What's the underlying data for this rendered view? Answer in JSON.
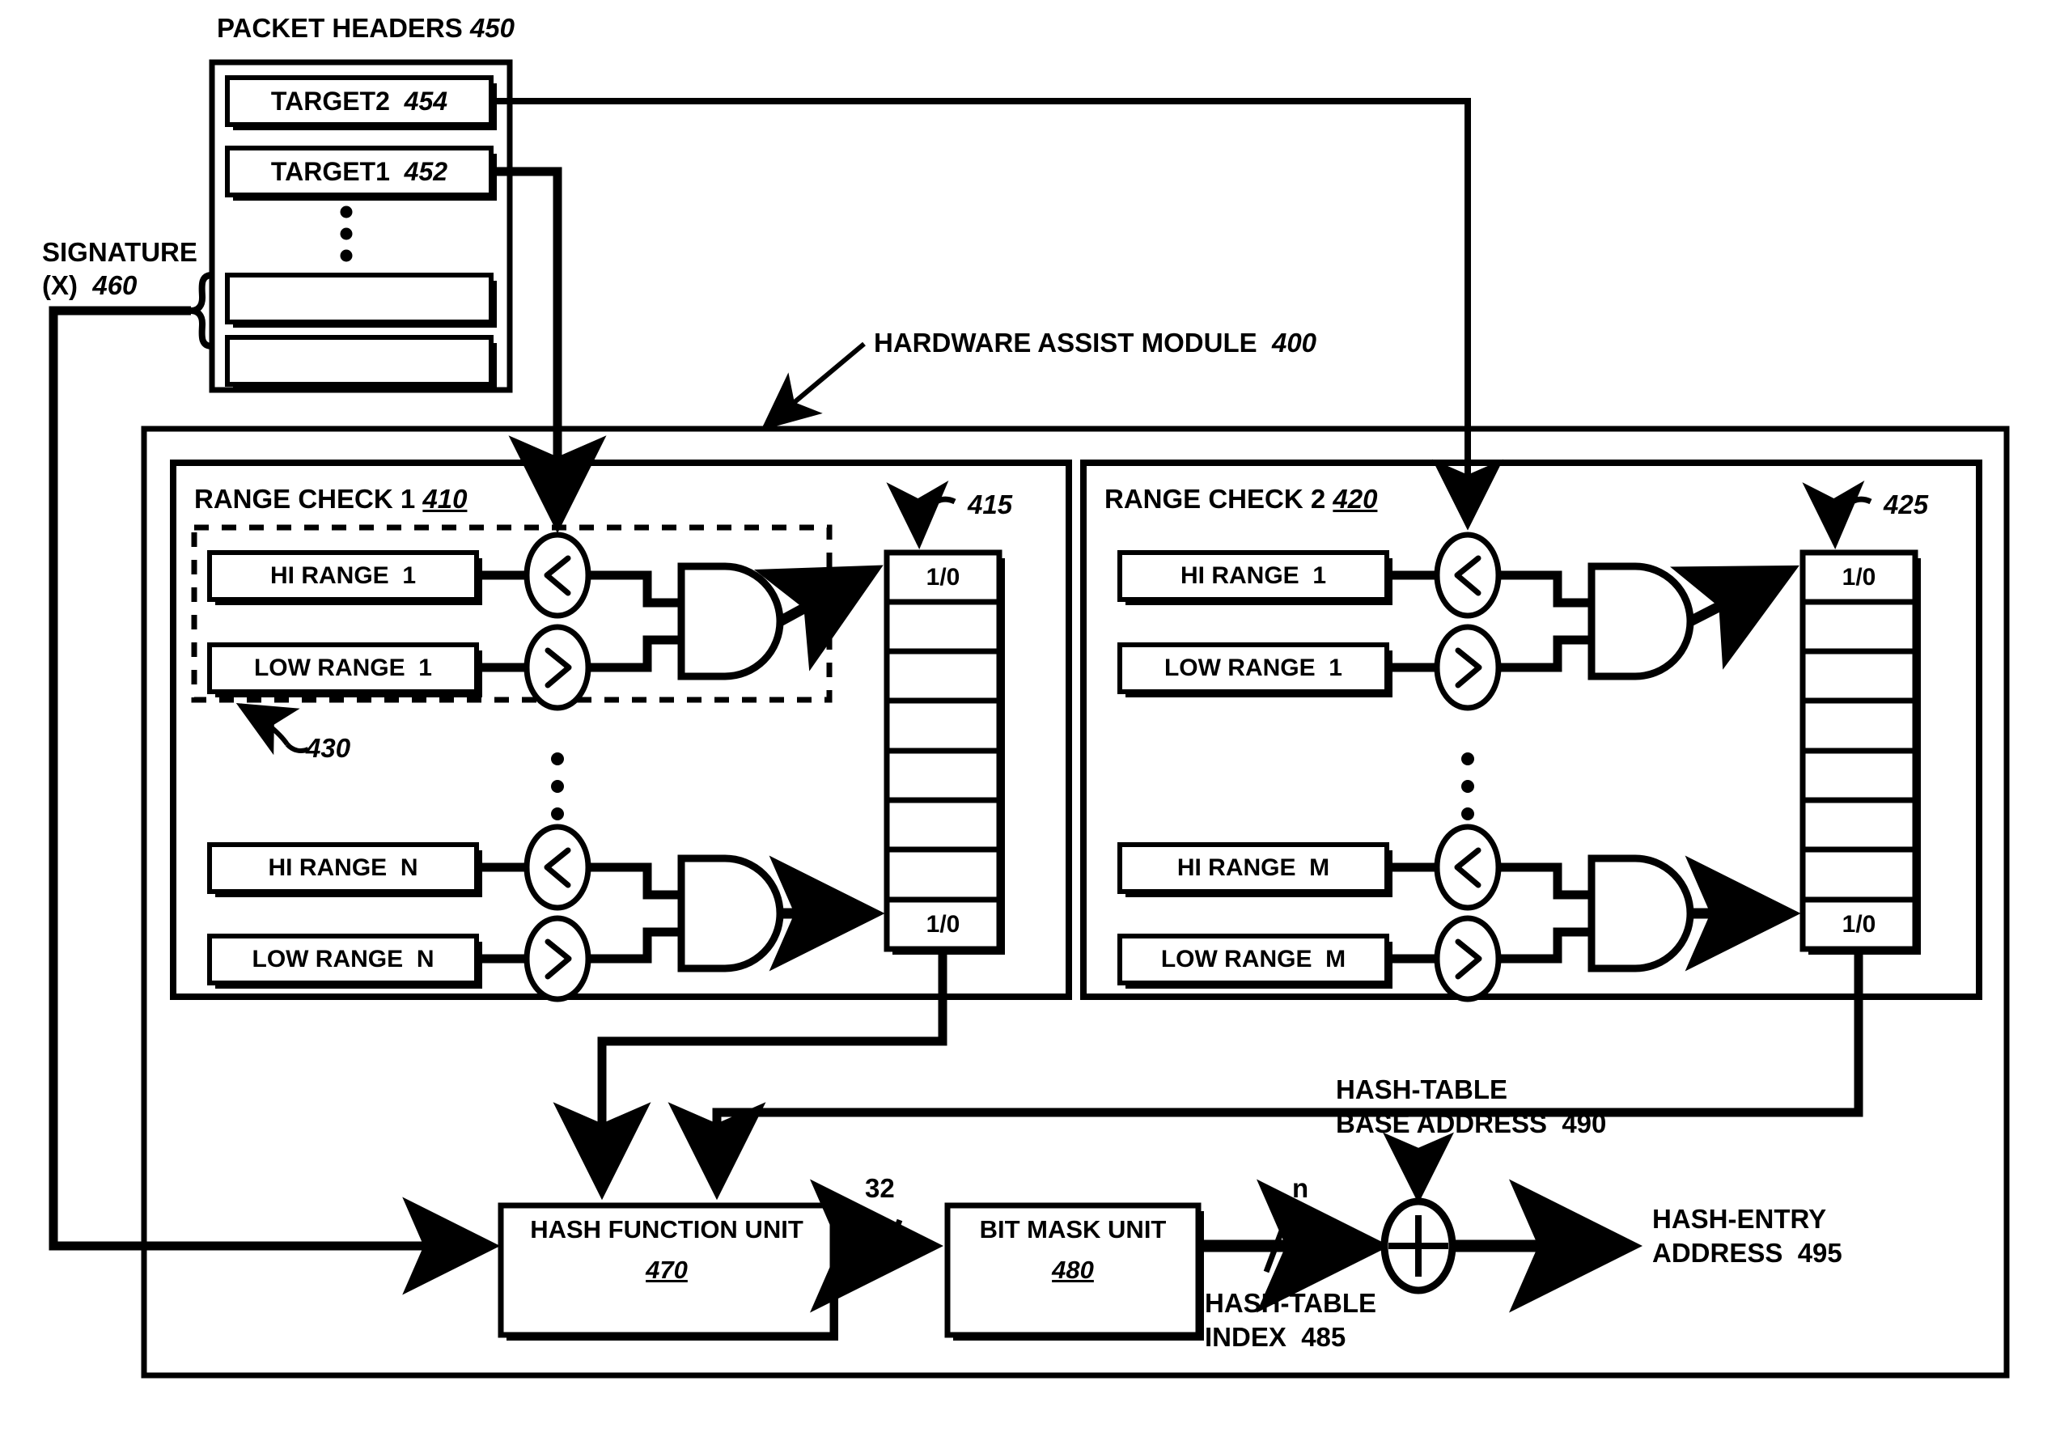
{
  "figure": {
    "title_parts": {
      "packet_headers_label": "PACKET HEADERS",
      "packet_headers_ref": "450",
      "hw_module_label": "HARDWARE ASSIST MODULE",
      "hw_module_ref": "400",
      "signature_label_line1": "SIGNATURE",
      "signature_label_line2": "(X)",
      "signature_ref": "460"
    }
  },
  "packet_headers": {
    "label": "PACKET HEADERS",
    "ref": "450",
    "rows": [
      {
        "name": "TARGET2",
        "ref": "454"
      },
      {
        "name": "TARGET1",
        "ref": "452"
      },
      {
        "name": "",
        "ref": ""
      },
      {
        "name": "",
        "ref": ""
      }
    ],
    "ellipsis": "•"
  },
  "signature": {
    "line1": "SIGNATURE",
    "line2": "(X)",
    "ref": "460"
  },
  "hardware_assist_module": {
    "label": "HARDWARE ASSIST MODULE",
    "ref": "400"
  },
  "range_check_1": {
    "label": "RANGE CHECK 1",
    "ref": "410",
    "register_ref": "415",
    "dashed_group_ref": "430",
    "pairs": [
      {
        "hi": "HI RANGE  1",
        "low": "LOW RANGE  1",
        "cmp_hi": "<",
        "cmp_low": ">"
      },
      {
        "hi": "HI RANGE  N",
        "low": "LOW RANGE  N",
        "cmp_hi": "<",
        "cmp_low": ">"
      }
    ],
    "register_cells": [
      "1/0",
      "",
      "",
      "",
      "",
      "",
      "",
      "1/0"
    ]
  },
  "range_check_2": {
    "label": "RANGE CHECK 2",
    "ref": "420",
    "register_ref": "425",
    "pairs": [
      {
        "hi": "HI RANGE  1",
        "low": "LOW RANGE  1",
        "cmp_hi": "<",
        "cmp_low": ">"
      },
      {
        "hi": "HI RANGE  M",
        "low": "LOW RANGE  M",
        "cmp_hi": "<",
        "cmp_low": ">"
      }
    ],
    "register_cells": [
      "1/0",
      "",
      "",
      "",
      "",
      "",
      "",
      "1/0"
    ]
  },
  "hash_function_unit": {
    "line1": "HASH FUNCTION UNIT",
    "ref": "470"
  },
  "bit_mask_unit": {
    "line1": "BIT MASK UNIT",
    "ref": "480"
  },
  "bus_widths": {
    "hash_out": "32",
    "mask_out": "n"
  },
  "hash_table_index": {
    "line1": "HASH-TABLE",
    "line2": "INDEX  485"
  },
  "hash_table_base_address": {
    "line1": "HASH-TABLE",
    "line2": "BASE ADDRESS  490"
  },
  "hash_entry_address": {
    "line1": "HASH-ENTRY",
    "line2": "ADDRESS  495"
  },
  "adder": {
    "symbol": "+"
  },
  "colors": {
    "ink": "#000000",
    "paper": "#ffffff"
  }
}
